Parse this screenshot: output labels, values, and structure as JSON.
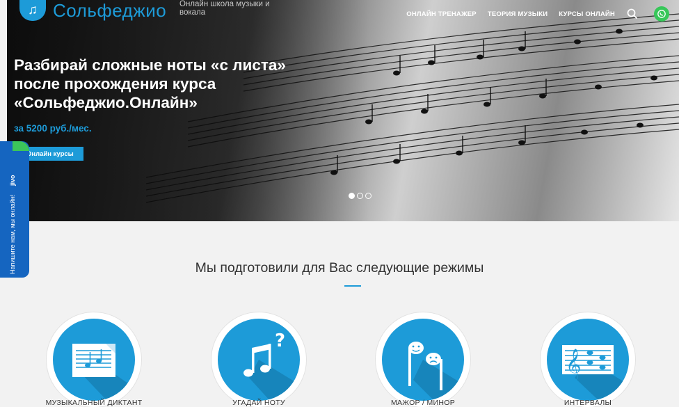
{
  "header": {
    "logo_text": "Сольфеджио",
    "logo_subtitle": "Онлайн школа музыки и вокала",
    "nav": [
      "ОНЛАЙН ТРЕНАЖЕР",
      "ТЕОРИЯ МУЗЫКИ",
      "КУРСЫ ОНЛАЙН"
    ]
  },
  "hero": {
    "title": "Разбирай сложные ноты «с листа» после прохождения курса «Сольфеджио.Онлайн»",
    "price": "за 5200 руб./мес.",
    "button_label": "Онлайн курсы",
    "slides_total": 3,
    "active_slide": 1
  },
  "chat_widget": {
    "text": "Напишите нам, мы онлайн!",
    "brand": "jivo"
  },
  "modes_section": {
    "title": "Мы подготовили для Вас следующие режимы",
    "items": [
      {
        "label": "МУЗЫКАЛЬНЫЙ ДИКТАНТ"
      },
      {
        "label": "УГАДАЙ НОТУ"
      },
      {
        "label": "МАЖОР / МИНОР"
      },
      {
        "label": "ИНТЕРВАЛЫ"
      }
    ]
  },
  "colors": {
    "accent": "#1d9bd8",
    "chat_blue": "#1565c0",
    "whatsapp_green": "#37c759"
  }
}
